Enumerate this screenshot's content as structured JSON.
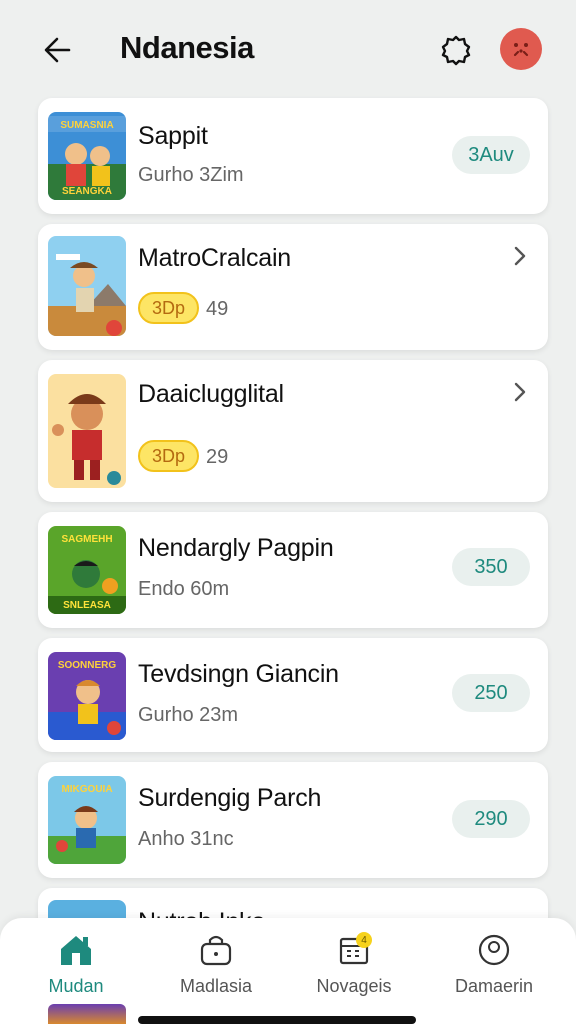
{
  "header": {
    "title": "Ndanesia",
    "back_icon": "arrow-left-icon",
    "settings_icon": "gear-icon",
    "avatar_icon": "profile-face-icon",
    "avatar_color": "#e05a4f"
  },
  "items": [
    {
      "title": "Sappit",
      "subtitle": "Gurho 3Zim",
      "action": "3Auv",
      "thumb_text": "SUMASNIA",
      "thumb_text2": "SEANGKA"
    },
    {
      "title": "MatroCralcain",
      "tag": "3Dp",
      "count": "49"
    },
    {
      "title": "Daaiclugglital",
      "tag": "3Dp",
      "count": "29"
    },
    {
      "title": "Nendargly Pagpin",
      "subtitle": "Endo 60m",
      "action": "350",
      "thumb_text": "SAGMEHH",
      "thumb_text2": "SNLEASA"
    },
    {
      "title": "Tevdsingn Giancin",
      "subtitle": "Gurho 23m",
      "action": "250",
      "thumb_text": "SOONNERG"
    },
    {
      "title": "Surdengig Parch",
      "subtitle": "Anho 31nc",
      "action": "290",
      "thumb_text": "MIKGOUIA"
    },
    {
      "title": "Nutrob Inko"
    }
  ],
  "bottom_nav": [
    {
      "label": "Mudan",
      "icon": "home-icon",
      "active": true
    },
    {
      "label": "Madlasia",
      "icon": "bag-icon",
      "active": false
    },
    {
      "label": "Novageis",
      "icon": "calendar-icon",
      "active": false,
      "badge": "4"
    },
    {
      "label": "Damaerin",
      "icon": "profile-icon",
      "active": false
    }
  ],
  "colors": {
    "accent": "#1e8a7e",
    "pill_bg": "#e9f0ee",
    "tag_bg": "#fde565",
    "background": "#eef0ef"
  }
}
